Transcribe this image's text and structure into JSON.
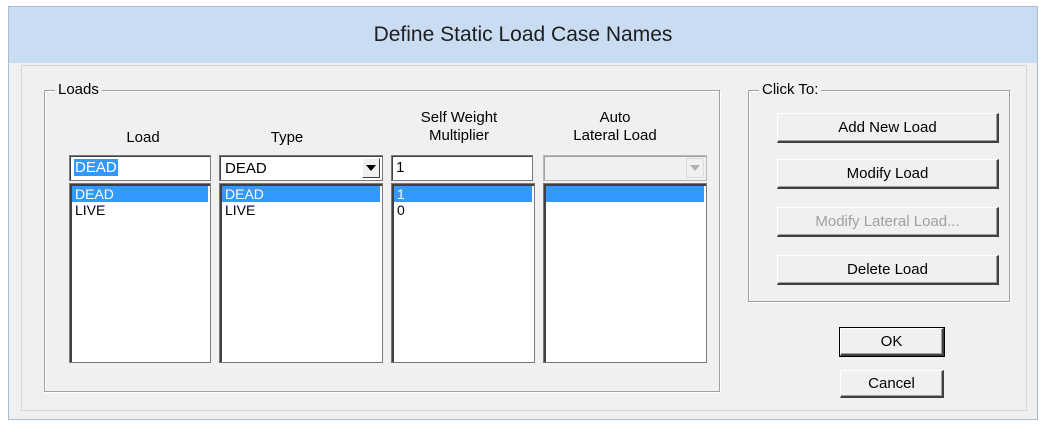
{
  "window": {
    "title": "Define Static Load Case Names"
  },
  "loads_group": {
    "legend": "Loads",
    "columns": {
      "load": "Load",
      "type": "Type",
      "self_weight_line1": "Self Weight",
      "self_weight_line2": "Multiplier",
      "auto_line1": "Auto",
      "auto_line2": "Lateral Load"
    },
    "inputs": {
      "load_name": "DEAD",
      "type_value": "DEAD",
      "self_weight": "1",
      "auto_lateral": ""
    },
    "rows": [
      {
        "load": "DEAD",
        "type": "DEAD",
        "self_weight": "1",
        "auto_lateral": ""
      },
      {
        "load": "LIVE",
        "type": "LIVE",
        "self_weight": "0",
        "auto_lateral": ""
      }
    ],
    "selected_row": 0
  },
  "click_to_group": {
    "legend": "Click To:",
    "add": "Add New Load",
    "modify": "Modify Load",
    "modify_lateral": "Modify Lateral Load...",
    "delete": "Delete Load"
  },
  "buttons": {
    "ok": "OK",
    "cancel": "Cancel"
  },
  "icons": {
    "dropdown": "chevron-down-icon"
  }
}
